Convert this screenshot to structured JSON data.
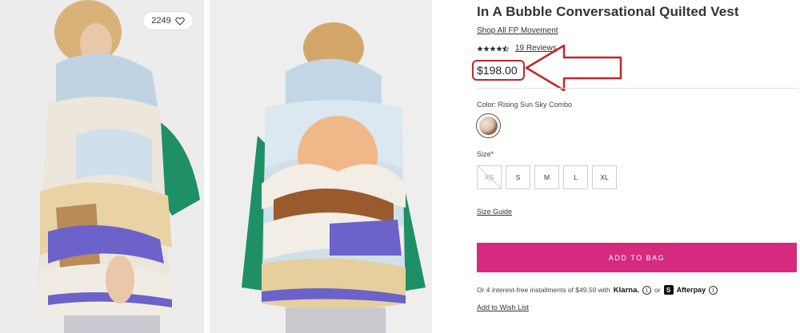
{
  "photos": {
    "front_alt": "",
    "favorite_count": "2249",
    "favorite_icon": "heart-icon"
  },
  "product": {
    "title": "In A Bubble Conversational Quilted Vest",
    "shop_link": "Shop All FP Movement",
    "rating_stars": 4.5,
    "reviews": "19 Reviews",
    "price": "$198.00"
  },
  "color": {
    "label": "Color: Rising Sun Sky Combo"
  },
  "size": {
    "label": "Size*",
    "options": [
      {
        "label": "XS",
        "available": false
      },
      {
        "label": "S",
        "available": true
      },
      {
        "label": "M",
        "available": true
      },
      {
        "label": "L",
        "available": true
      },
      {
        "label": "XL",
        "available": true
      }
    ],
    "guide": "Size Guide"
  },
  "cart": {
    "add_to_bag": "ADD TO BAG"
  },
  "payment": {
    "installment_text": "Or 4 interest-free installments of $49.50 with",
    "klarna": "Klarna.",
    "or": "or",
    "afterpay": "Afterpay",
    "afterpay_mark": "S",
    "info_glyph": "i"
  },
  "wishlist": "Add to Wish List",
  "colors": {
    "accent": "#d62a7e",
    "annotation": "#c1272d"
  }
}
